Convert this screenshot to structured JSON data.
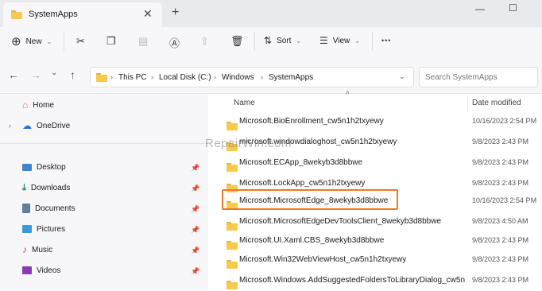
{
  "window": {
    "tab_title": "SystemApps",
    "new_tab": "+"
  },
  "window_controls": {
    "minimize": "—",
    "maximize": "☐"
  },
  "toolbar": {
    "new_label": "New",
    "sort_label": "Sort",
    "view_label": "View",
    "more": "•••"
  },
  "address": {
    "crumbs": [
      "This PC",
      "Local Disk (C:)",
      "Windows",
      "SystemApps"
    ],
    "separator": "›"
  },
  "search": {
    "placeholder": "Search SystemApps"
  },
  "nav": {
    "items": [
      {
        "label": "Home"
      },
      {
        "label": "OneDrive"
      },
      {
        "label": "Desktop"
      },
      {
        "label": "Downloads"
      },
      {
        "label": "Documents"
      },
      {
        "label": "Pictures"
      },
      {
        "label": "Music"
      },
      {
        "label": "Videos"
      }
    ]
  },
  "columns": {
    "name": "Name",
    "date": "Date modified"
  },
  "files": [
    {
      "name": "Microsoft.BioEnrollment_cw5n1h2txyewy",
      "date": "10/16/2023 2:54 PM"
    },
    {
      "name": "microsoft.windowdialoghost_cw5n1h2txyewy",
      "date": "9/8/2023 2:43 PM"
    },
    {
      "name": "Microsoft.ECApp_8wekyb3d8bbwe",
      "date": "9/8/2023 2:43 PM"
    },
    {
      "name": "Microsoft.LockApp_cw5n1h2txyewy",
      "date": "9/8/2023 2:43 PM"
    },
    {
      "name": "Microsoft.MicrosoftEdge_8wekyb3d8bbwe",
      "date": "10/16/2023 2:54 PM",
      "highlighted": true
    },
    {
      "name": "Microsoft.MicrosoftEdgeDevToolsClient_8wekyb3d8bbwe",
      "date": "9/8/2023 4:50 AM"
    },
    {
      "name": "Microsoft.UI.Xaml.CBS_8wekyb3d8bbwe",
      "date": "9/8/2023 2:43 PM"
    },
    {
      "name": "Microsoft.Win32WebViewHost_cw5n1h2txyewy",
      "date": "9/8/2023 2:43 PM"
    },
    {
      "name": "Microsoft.Windows.AddSuggestedFoldersToLibraryDialog_cw5n",
      "date": "9/8/2023 2:43 PM"
    }
  ],
  "watermark": "RepairWin.com",
  "colors": {
    "highlight": "#ee7b22",
    "folder": "#f7c94c",
    "home_accent": "#e0733a",
    "onedrive": "#1a73d9"
  }
}
